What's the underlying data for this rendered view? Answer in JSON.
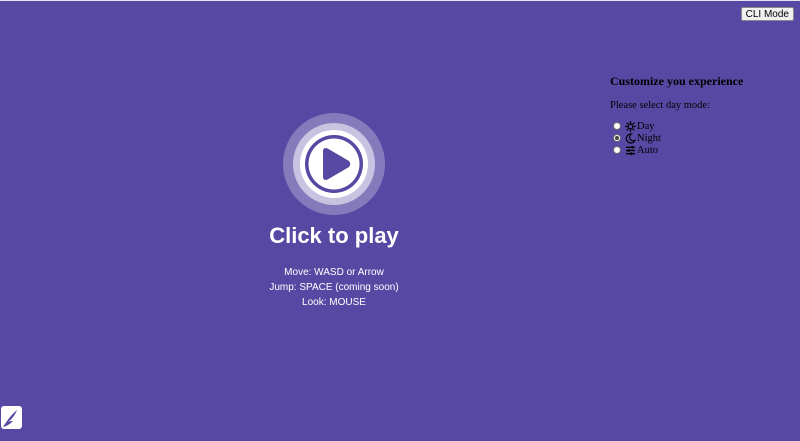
{
  "header": {
    "cli_button_label": "CLI Mode"
  },
  "play": {
    "title": "Click to play",
    "controls": [
      "Move: WASD or Arrow",
      "Jump: SPACE (coming soon)",
      "Look: MOUSE"
    ]
  },
  "settings": {
    "title": "Customize you experience",
    "prompt": "Please select day mode:",
    "options": [
      {
        "label": "Day",
        "icon": "sun-icon",
        "selected": false
      },
      {
        "label": "Night",
        "icon": "moon-icon",
        "selected": true
      },
      {
        "label": "Auto",
        "icon": "sliders-icon",
        "selected": false
      }
    ]
  },
  "colors": {
    "background": "#5749a3",
    "text_light": "#ffffff"
  }
}
